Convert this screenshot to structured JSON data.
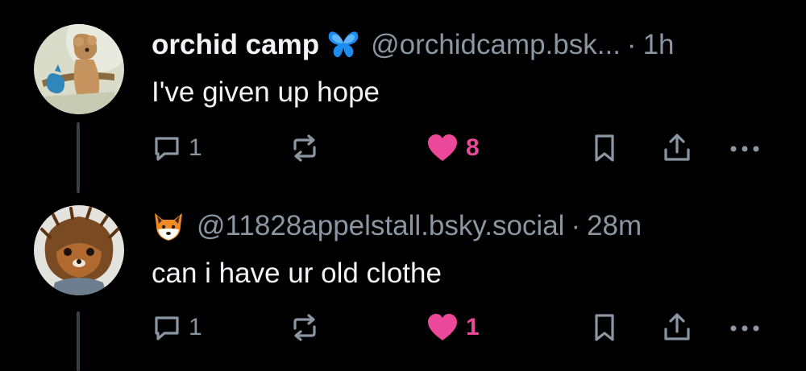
{
  "posts": [
    {
      "display_name": "orchid camp",
      "badge": "butterfly-icon",
      "handle": "@orchidcamp.bsk...",
      "separator": "·",
      "time": "1h",
      "text": "I've given up hope",
      "reply_count": "1",
      "like_count": "8",
      "liked": true
    },
    {
      "display_name": "",
      "badge": "fox-emoji",
      "badge_glyph": "🦊",
      "handle": "@11828appelstall.bsky.social",
      "separator": "·",
      "time": "28m",
      "text": "can i have ur old clothe",
      "reply_count": "1",
      "like_count": "1",
      "liked": true
    }
  ],
  "colors": {
    "background": "#000000",
    "text": "#f1f3f5",
    "muted": "#8b96a3",
    "like": "#ec4899",
    "thread_line": "#3a3f46"
  }
}
